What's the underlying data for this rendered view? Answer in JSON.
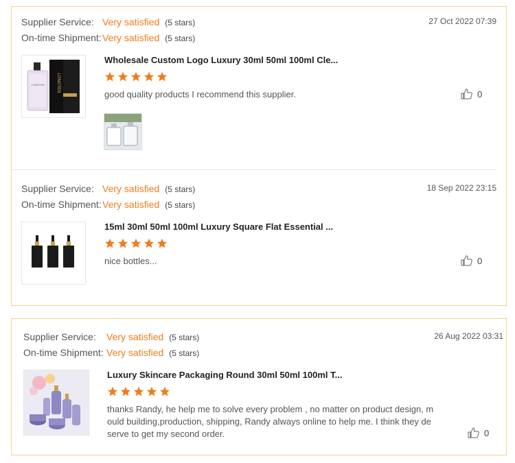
{
  "reviews": [
    {
      "supplier_label": "Supplier Service:",
      "supplier_value": "Very satisfied",
      "supplier_stars": "(5 stars)",
      "shipment_label": "On-time Shipment:",
      "shipment_value": "Very satisfied",
      "shipment_stars": "(5 stars)",
      "date": "27 Oct 2022 07:39",
      "product_title": "Wholesale Custom Logo Luxury 30ml 50ml 100ml Cle...",
      "rating": 5,
      "comment": "good quality products I recommend this supplier.",
      "likes": "0",
      "thumb_brand": "LONGTEN"
    },
    {
      "supplier_label": "Supplier Service:",
      "supplier_value": "Very satisfied",
      "supplier_stars": "(5 stars)",
      "shipment_label": "On-time Shipment:",
      "shipment_value": "Very satisfied",
      "shipment_stars": "(5 stars)",
      "date": "18 Sep 2022 23:15",
      "product_title": "15ml 30ml 50ml 100ml Luxury Square Flat Essential ...",
      "rating": 5,
      "comment": "nice bottles...",
      "likes": "0"
    },
    {
      "supplier_label": "Supplier Service:",
      "supplier_value": "Very satisfied",
      "supplier_stars": "(5 stars)",
      "shipment_label": "On-time Shipment:",
      "shipment_value": "Very satisfied",
      "shipment_stars": "(5 stars)",
      "date": "26 Aug 2022 03:31",
      "product_title": "Luxury Skincare Packaging Round 30ml 50ml 100ml T...",
      "rating": 5,
      "comment_lines": [
        "thanks Randy, he help me to solve every problem , no matter on product design, m",
        "ould building,production, shipping, Randy always online to help me. I think they de",
        "serve to get my second order."
      ],
      "likes": "0"
    }
  ],
  "colors": {
    "accent": "#f07c1b",
    "border": "#f0d58a",
    "star": "#f07c1b"
  },
  "icons": {
    "star": "star-icon",
    "like": "thumbs-up-icon"
  }
}
